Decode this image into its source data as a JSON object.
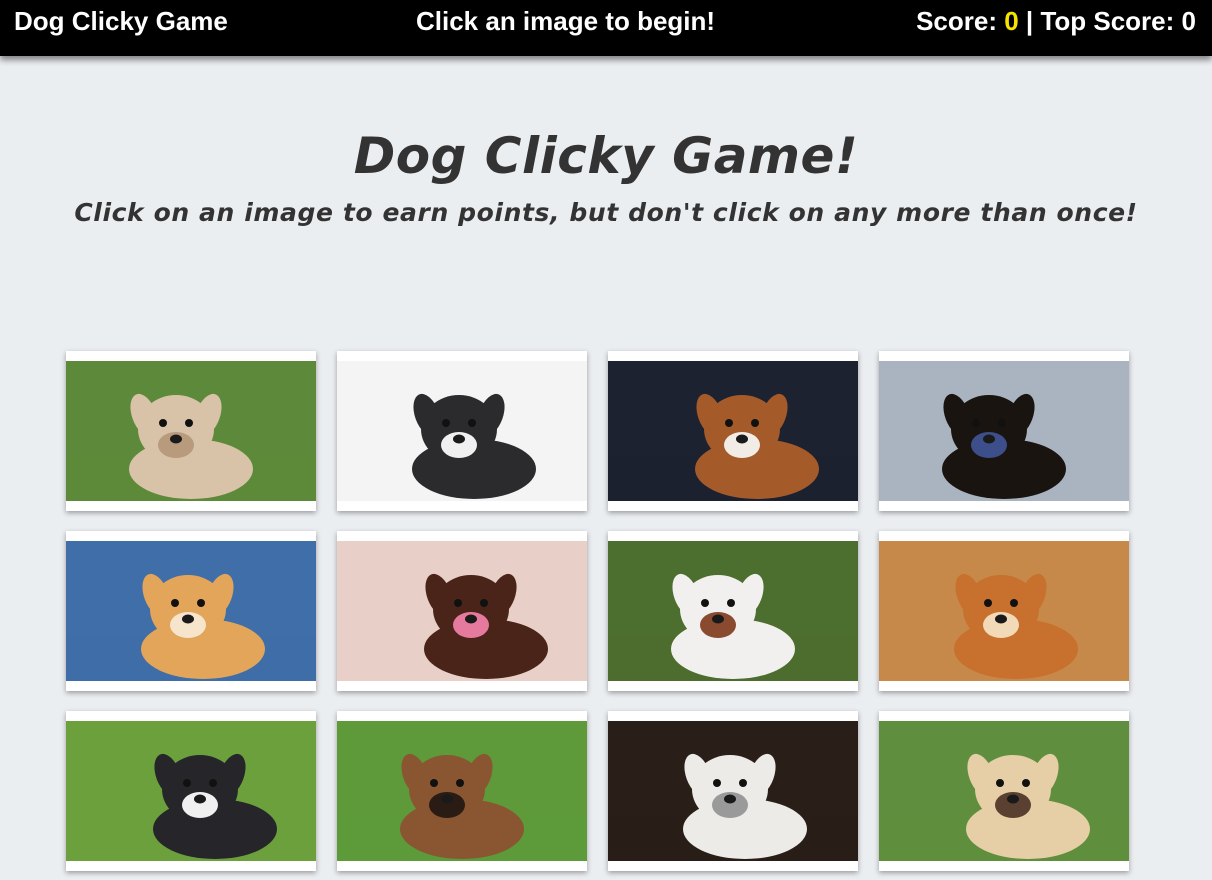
{
  "navbar": {
    "brand": "Dog Clicky Game",
    "message": "Click an image to begin!",
    "score_label": "Score: ",
    "score_value": "0",
    "separator": " | ",
    "top_score_label": "Top Score: ",
    "top_score_value": "0"
  },
  "header": {
    "title": "Dog Clicky Game!",
    "subtitle": "Click on an image to earn points, but don't click on any more than once!"
  },
  "colors": {
    "navbar_bg": "#000000",
    "score_accent": "#f5e300",
    "page_bg": "#ebeef1",
    "heading": "#333333"
  },
  "cards": [
    {
      "name": "dog-card-soft-coated-wheaten",
      "bg": "#5c8a3a",
      "fur": "#d8c3a8",
      "accent": "#b89a7c"
    },
    {
      "name": "dog-card-boston-terrier",
      "bg": "#f4f4f4",
      "fur": "#2b2b2e",
      "accent": "#f0f0f0"
    },
    {
      "name": "dog-card-beagle",
      "bg": "#1c2230",
      "fur": "#a55a2a",
      "accent": "#f2ece6"
    },
    {
      "name": "dog-card-doberman-in-car",
      "bg": "#a9b4c0",
      "fur": "#1a1410",
      "accent": "#3d4f8a"
    },
    {
      "name": "dog-card-pomeranian",
      "bg": "#3f6ea8",
      "fur": "#e3a55a",
      "accent": "#f6e4cc"
    },
    {
      "name": "dog-card-poodle",
      "bg": "#e8cfc8",
      "fur": "#4a2418",
      "accent": "#e67a9e"
    },
    {
      "name": "dog-card-boxer",
      "bg": "#4c6e2e",
      "fur": "#f2f0ee",
      "accent": "#8a4a30"
    },
    {
      "name": "dog-card-chow-chow",
      "bg": "#c7894a",
      "fur": "#c8702e",
      "accent": "#f2d9b8"
    },
    {
      "name": "dog-card-corgi-mix",
      "bg": "#6ca03c",
      "fur": "#26262a",
      "accent": "#f0f0f0"
    },
    {
      "name": "dog-card-bullmastiff",
      "bg": "#5e9a3a",
      "fur": "#8a5632",
      "accent": "#2a1c14"
    },
    {
      "name": "dog-card-old-english-sheepdog",
      "bg": "#2a1e18",
      "fur": "#ecebe8",
      "accent": "#9a9a9a"
    },
    {
      "name": "dog-card-afghan-hound",
      "bg": "#5f8f3e",
      "fur": "#e6cfa6",
      "accent": "#5a4030"
    }
  ]
}
